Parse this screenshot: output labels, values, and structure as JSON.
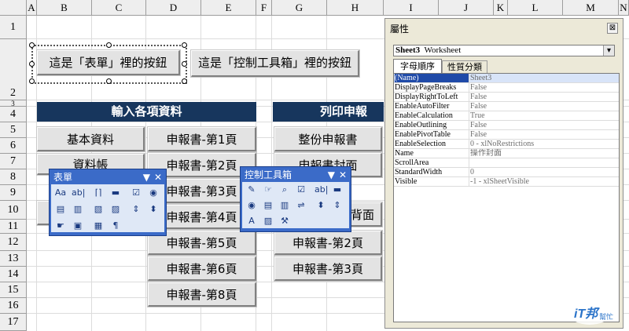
{
  "columns": [
    "A",
    "B",
    "C",
    "D",
    "E",
    "F",
    "G",
    "H",
    "I",
    "J",
    "K",
    "L",
    "M",
    "N"
  ],
  "rows": [
    "1",
    "2",
    "3",
    "4",
    "5",
    "6",
    "7",
    "8",
    "9",
    "10",
    "11",
    "12",
    "13",
    "14",
    "15",
    "16",
    "17"
  ],
  "sheet": {
    "form_button": "這是「表單」裡的按鈕",
    "control_button": "這是「控制工具箱」裡的按鈕",
    "section_input": "輸入各項資料",
    "section_print": "列印申報",
    "input_buttons": [
      "基本資料",
      "資料帳"
    ],
    "report_buttons": [
      "申報書-第1頁",
      "申報書-第2頁",
      "申報書-第3頁",
      "申報書-第4頁",
      "申報書-第5頁",
      "申報書-第6頁",
      "申報書-第8頁"
    ],
    "print_buttons": [
      "整份申報書",
      "申報書封面",
      "背面",
      "申報書-第2頁",
      "申報書-第3頁"
    ]
  },
  "form_toolbar": {
    "title": "表單",
    "menu_glyph": "▼",
    "close_glyph": "✕",
    "tools": [
      {
        "icon": "label-icon",
        "glyph": "Aa"
      },
      {
        "icon": "textbox-icon",
        "glyph": "ab|"
      },
      {
        "icon": "groupbox-icon",
        "glyph": "⌈⌉"
      },
      {
        "icon": "button-icon",
        "glyph": "▬"
      },
      {
        "icon": "checkbox-icon",
        "glyph": "☑"
      },
      {
        "icon": "radio-icon",
        "glyph": "◉"
      },
      {
        "icon": "listbox-icon",
        "glyph": "▤"
      },
      {
        "icon": "combobox-icon",
        "glyph": "▥"
      },
      {
        "icon": "combo-list-icon",
        "glyph": "▧"
      },
      {
        "icon": "combo-dropdown-icon",
        "glyph": "▨"
      },
      {
        "icon": "scrollbar-icon",
        "glyph": "⇕"
      },
      {
        "icon": "spinner-icon",
        "glyph": "⬍"
      },
      {
        "icon": "control-properties-icon",
        "glyph": "☛"
      },
      {
        "icon": "edit-code-icon",
        "glyph": "▣"
      },
      {
        "icon": "toggle-grid-icon",
        "glyph": "▦"
      },
      {
        "icon": "run-dialog-icon",
        "glyph": "¶"
      }
    ]
  },
  "control_toolbar": {
    "title": "控制工具箱",
    "menu_glyph": "▼",
    "close_glyph": "✕",
    "tools": [
      {
        "icon": "design-mode-icon",
        "glyph": "✎"
      },
      {
        "icon": "properties-icon",
        "glyph": "☞"
      },
      {
        "icon": "view-code-icon",
        "glyph": "⌕"
      },
      {
        "icon": "checkbox-icon",
        "glyph": "☑"
      },
      {
        "icon": "textbox-icon",
        "glyph": "ab|"
      },
      {
        "icon": "command-button-icon",
        "glyph": "▬"
      },
      {
        "icon": "option-button-icon",
        "glyph": "◉"
      },
      {
        "icon": "listbox-icon",
        "glyph": "▤"
      },
      {
        "icon": "combobox-icon",
        "glyph": "▥"
      },
      {
        "icon": "toggle-button-icon",
        "glyph": "⇌"
      },
      {
        "icon": "spin-button-icon",
        "glyph": "⬍"
      },
      {
        "icon": "scrollbar-icon",
        "glyph": "⇕"
      },
      {
        "icon": "label-icon",
        "glyph": "A"
      },
      {
        "icon": "image-icon",
        "glyph": "▨"
      },
      {
        "icon": "more-controls-icon",
        "glyph": "⚒"
      }
    ]
  },
  "properties": {
    "title": "屬性",
    "close_glyph": "⊠",
    "object_name": "Sheet3",
    "object_type": "Worksheet",
    "dropdown_glyph": "▾",
    "tabs": [
      "字母順序",
      "性質分類"
    ],
    "rows": [
      {
        "key": "(Name)",
        "value": "Sheet3"
      },
      {
        "key": "DisplayPageBreaks",
        "value": "False"
      },
      {
        "key": "DisplayRightToLeft",
        "value": "False"
      },
      {
        "key": "EnableAutoFilter",
        "value": "False"
      },
      {
        "key": "EnableCalculation",
        "value": "True"
      },
      {
        "key": "EnableOutlining",
        "value": "False"
      },
      {
        "key": "EnablePivotTable",
        "value": "False"
      },
      {
        "key": "EnableSelection",
        "value": "0 - xlNoRestrictions"
      },
      {
        "key": "Name",
        "value": "操作封面"
      },
      {
        "key": "ScrollArea",
        "value": ""
      },
      {
        "key": "StandardWidth",
        "value": "0"
      },
      {
        "key": "Visible",
        "value": "-1 - xlSheetVisible"
      }
    ]
  },
  "watermark": {
    "brand": "iT邦",
    "sub": "幫忙"
  }
}
